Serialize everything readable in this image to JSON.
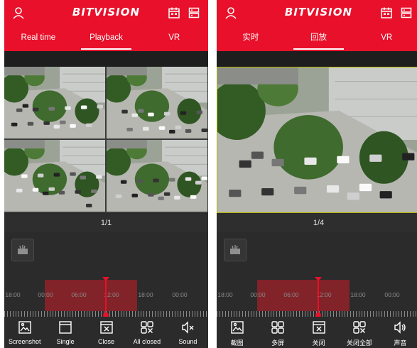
{
  "colors": {
    "brand_red": "#e8102a",
    "dark_bg": "#2b2b2b",
    "timeline_text": "#8a8a8a"
  },
  "screens": [
    {
      "id": "left",
      "brand": "BITVISION",
      "tabs": [
        "Real time",
        "Playback",
        "VR"
      ],
      "active_tab": 1,
      "layout": "quad",
      "pager": "1/1",
      "timeline": {
        "ticks": [
          "18:00",
          "00:00",
          "06:00",
          "12:00",
          "18:00",
          "00:00"
        ]
      },
      "toolbar": [
        {
          "label": "Screenshot",
          "icon": "screenshot-icon"
        },
        {
          "label": "Single",
          "icon": "single-screen-icon"
        },
        {
          "label": "Close",
          "icon": "close-icon"
        },
        {
          "label": "All closed",
          "icon": "close-all-icon"
        },
        {
          "label": "Sound",
          "icon": "sound-muted-icon"
        }
      ]
    },
    {
      "id": "right",
      "brand": "BITVISION",
      "tabs": [
        "实时",
        "回放",
        "VR"
      ],
      "active_tab": 1,
      "layout": "single",
      "pager": "1/4",
      "timeline": {
        "ticks": [
          "18:00",
          "00:00",
          "06:00",
          "12:00",
          "18:00",
          "00:00"
        ]
      },
      "toolbar": [
        {
          "label": "截图",
          "icon": "screenshot-icon"
        },
        {
          "label": "多屏",
          "icon": "multi-screen-icon"
        },
        {
          "label": "关闭",
          "icon": "close-icon"
        },
        {
          "label": "关闭全部",
          "icon": "close-all-icon"
        },
        {
          "label": "声音",
          "icon": "sound-on-icon"
        }
      ]
    }
  ]
}
